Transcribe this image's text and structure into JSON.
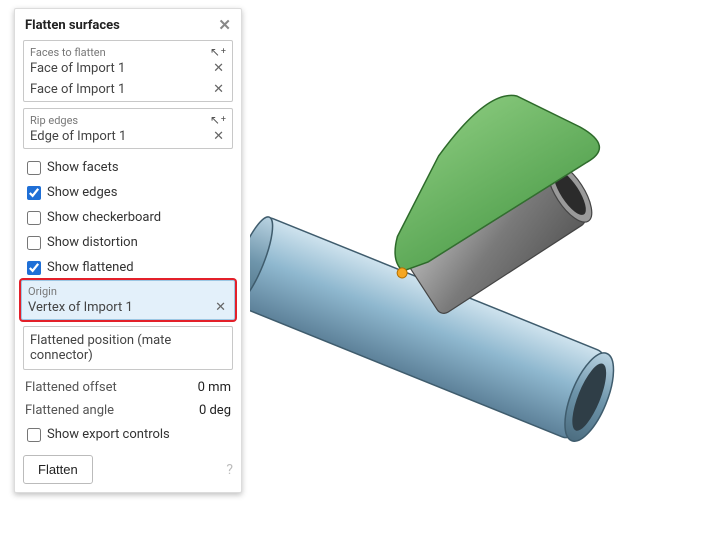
{
  "panel": {
    "title": "Flatten surfaces",
    "faces": {
      "label": "Faces to flatten",
      "items": [
        "Face of Import 1",
        "Face of Import 1"
      ]
    },
    "rip": {
      "label": "Rip edges",
      "items": [
        "Edge of Import 1"
      ]
    },
    "checks": {
      "facets": {
        "label": "Show facets",
        "checked": false
      },
      "edges": {
        "label": "Show edges",
        "checked": true
      },
      "checker": {
        "label": "Show checkerboard",
        "checked": false
      },
      "distortion": {
        "label": "Show distortion",
        "checked": false
      },
      "flattened": {
        "label": "Show flattened",
        "checked": true
      }
    },
    "origin": {
      "label": "Origin",
      "value": "Vertex of Import 1"
    },
    "mate": {
      "label": "Flattened position (mate connector)"
    },
    "offset": {
      "label": "Flattened offset",
      "value": "0 mm"
    },
    "angle": {
      "label": "Flattened angle",
      "value": "0 deg"
    },
    "export": {
      "label": "Show export controls",
      "checked": false
    },
    "button": "Flatten"
  }
}
